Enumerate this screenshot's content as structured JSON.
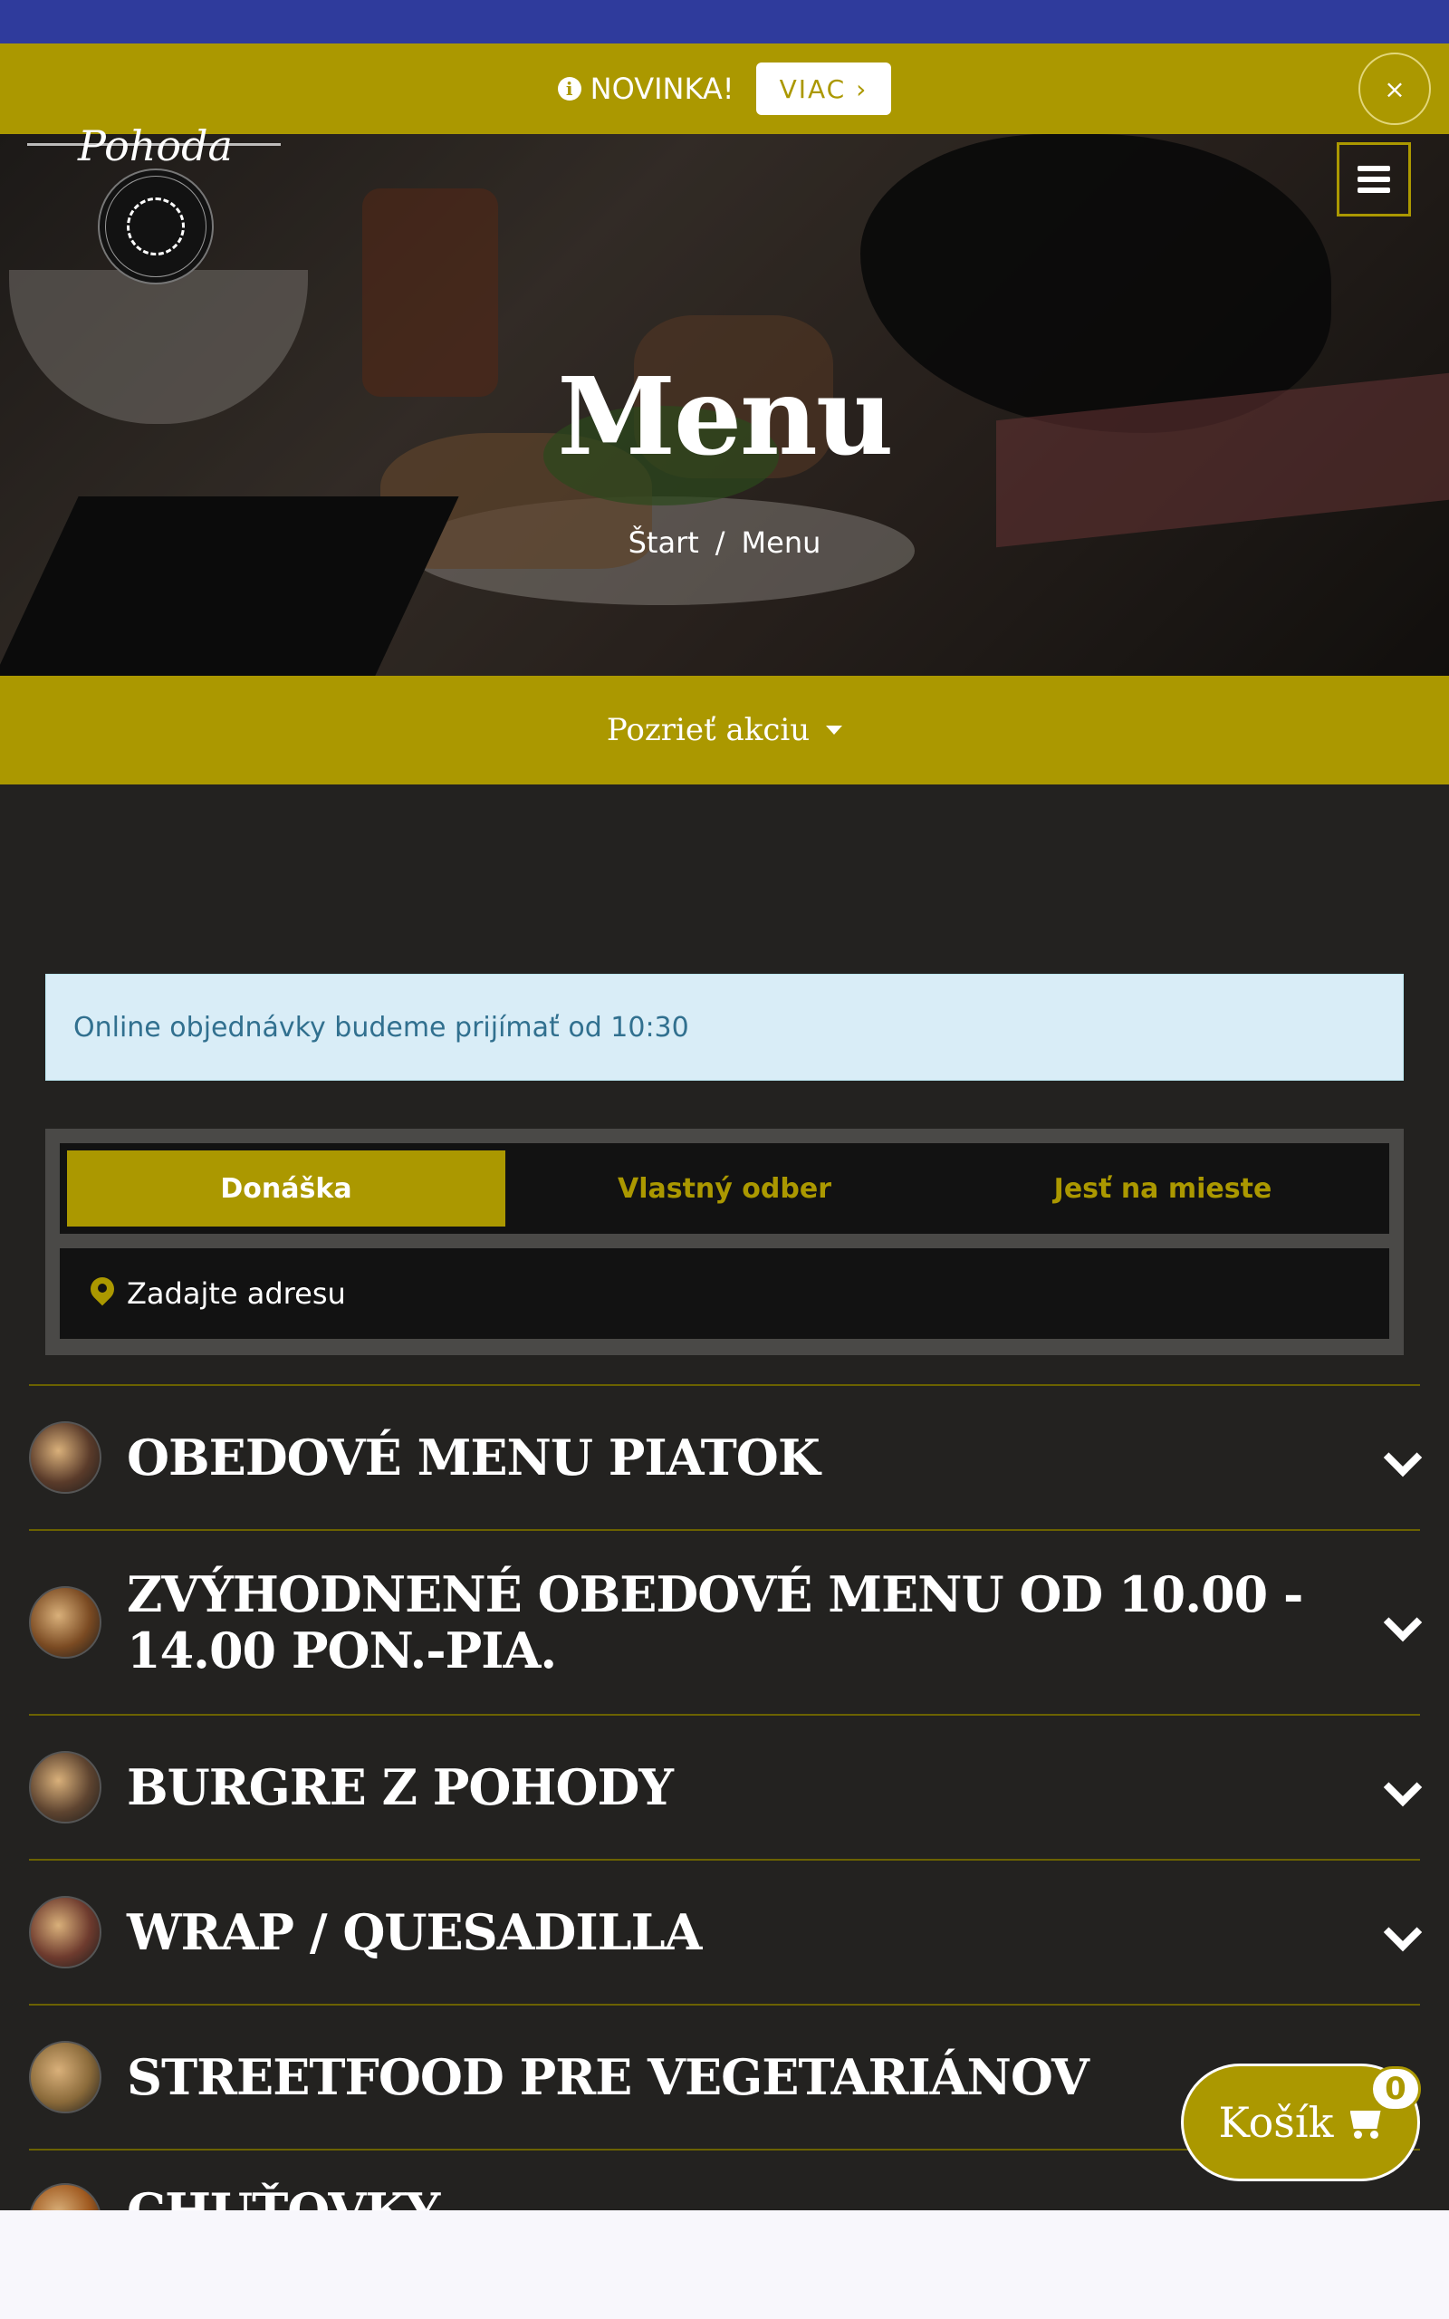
{
  "colors": {
    "accent": "#ab9800",
    "topbar": "#2f3b9c",
    "dark_bg": "#232220",
    "notice_bg": "#d9edf7",
    "notice_text": "#31708f"
  },
  "promo": {
    "text": "NOVINKA!",
    "button": "VIAC ›",
    "close": "×"
  },
  "logo": {
    "script": "Pohoda"
  },
  "hero": {
    "title": "Menu",
    "breadcrumb": {
      "home": "Štart",
      "separator": "/",
      "current": "Menu"
    }
  },
  "action_bar": {
    "label": "Pozrieť akciu"
  },
  "notice": {
    "text": "Online objednávky budeme prijímať od 10:30"
  },
  "order_modes": {
    "tabs": [
      "Donáška",
      "Vlastný odber",
      "Jesť na mieste"
    ],
    "active": "Donáška"
  },
  "address": {
    "placeholder": "Zadajte adresu"
  },
  "categories": [
    {
      "title": "OBEDOVÉ MENU PIATOK",
      "thumb": "#5a3b2a"
    },
    {
      "title": "ZVÝHODNENÉ OBEDOVÉ MENU OD 10.00 - 14.00 PON.-PIA.",
      "thumb": "#7a4a22"
    },
    {
      "title": "BURGRE Z POHODY",
      "thumb": "#5e4430"
    },
    {
      "title": "WRAP / QUESADILLA",
      "thumb": "#6e3b2e"
    },
    {
      "title": "STREETFOOD PRE VEGETARIÁNOV",
      "thumb": "#8a6a3a"
    },
    {
      "title": "CHUŤOVKY",
      "thumb": "#a05a20"
    }
  ],
  "cart": {
    "label": "Košík",
    "count": "0"
  }
}
